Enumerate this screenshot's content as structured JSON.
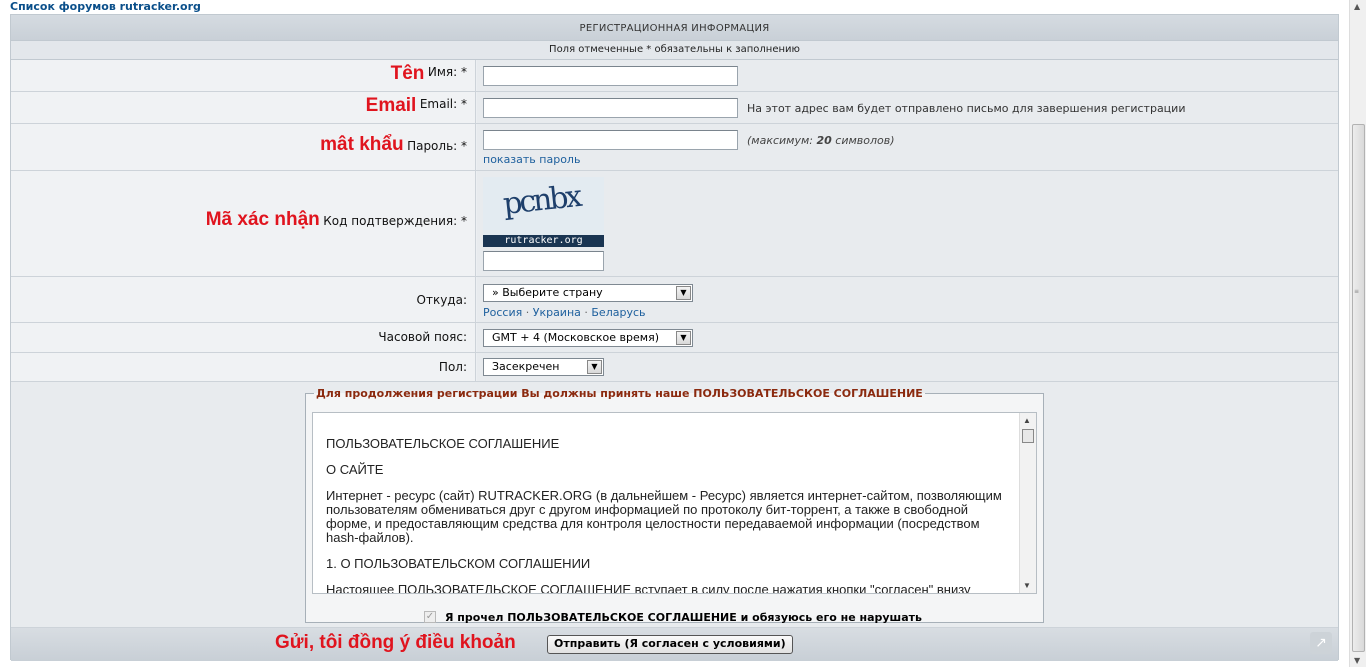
{
  "breadcrumb": "Список форумов rutracker.org",
  "form": {
    "header": "РЕГИСТРАЦИОННАЯ ИНФОРМАЦИЯ",
    "subheader": "Поля отмеченные * обязательны к заполнению",
    "name": {
      "annotation": "Tên",
      "label": "Имя: *",
      "value": ""
    },
    "email": {
      "annotation": "Email",
      "label": "Email: *",
      "value": "",
      "hint": "На этот адрес вам будет отправлено письмо для завершения регистрации"
    },
    "password": {
      "annotation": "mât khẩu",
      "label": "Пароль: *",
      "value": "",
      "hint_prefix": "(максимум: ",
      "hint_number": "20",
      "hint_suffix": " символов)",
      "show_link": "показать пароль"
    },
    "captcha": {
      "annotation": "Mã xác nhận",
      "label": "Код подтверждения: *",
      "image_text": "pcnbx",
      "image_brand": "rutracker.org",
      "value": ""
    },
    "country": {
      "label": "Откуда:",
      "selected": "» Выберите страну",
      "quick_links": [
        "Россия",
        "Украина",
        "Беларусь"
      ],
      "separator": "·"
    },
    "timezone": {
      "label": "Часовой пояс:",
      "selected": "GMT + 4 (Московское время)"
    },
    "gender": {
      "label": "Пол:",
      "selected": "Засекречен"
    }
  },
  "agreement": {
    "legend": "Для продолжения регистрации Вы должны принять наше ПОЛЬЗОВАТЕЛЬСКОЕ СОГЛАШЕНИЕ",
    "paragraphs": [
      "ПОЛЬЗОВАТЕЛЬСКОЕ СОГЛАШЕНИЕ",
      "О САЙТЕ",
      "Интернет - ресурс (сайт) RUTRACKER.ORG (в дальнейшем - Ресурс) является интернет-сайтом, позволяющим пользователям обмениваться друг с другом информацией по протоколу бит-торрент, а также в свободной форме, и предоставляющим средства для контроля целостности передаваемой информации (посредством hash-файлов).",
      "1. О ПОЛЬЗОВАТЕЛЬСКОМ СОГЛАШЕНИИ",
      "Настоящее ПОЛЬЗОВАТЕЛЬСКОЕ СОГЛАШЕНИЕ вступает в силу после нажатия кнопки \"согласен\" внизу"
    ],
    "checkbox_label": "Я прочел ПОЛЬЗОВАТЕЛЬСКОЕ СОГЛАШЕНИЕ и обязуюсь его не нарушать",
    "checkbox_mark": "✓"
  },
  "footer": {
    "annotation": "Gửi, tôi đồng ý điều khoản",
    "submit_label": "Отправить (Я согласен с условиями)",
    "share_icon": "↗"
  },
  "icons": {
    "dropdown": "▼",
    "scroll_up": "▲",
    "scroll_down": "▼",
    "grip": "≡"
  },
  "colors": {
    "annotation": "#e0141e",
    "link": "#1d5f9d",
    "legend": "#8b2a0f"
  }
}
